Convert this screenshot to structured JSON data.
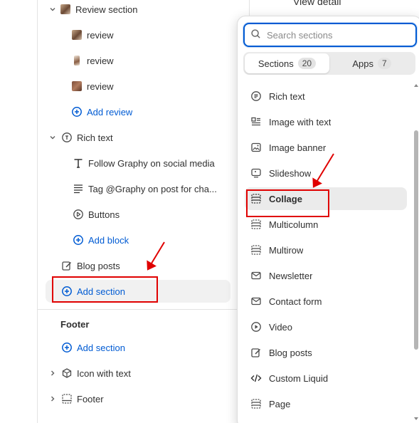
{
  "tree": {
    "review_section": "Review section",
    "reviews": [
      "review",
      "review",
      "review"
    ],
    "add_review": "Add review",
    "rich_text": "Rich text",
    "follow_graphy": "Follow Graphy on social media",
    "tag_graphy": "Tag @Graphy on post for cha...",
    "buttons": "Buttons",
    "add_block": "Add block",
    "blog_posts": "Blog posts",
    "add_section": "Add section"
  },
  "footer": {
    "title": "Footer",
    "add_section": "Add section",
    "icon_with_text": "Icon with text",
    "footer_item": "Footer"
  },
  "header": {
    "view_detail": "View detail"
  },
  "popup": {
    "search_placeholder": "Search sections",
    "tabs": [
      {
        "label": "Sections",
        "count": "20"
      },
      {
        "label": "Apps",
        "count": "7"
      }
    ],
    "items": [
      {
        "label": "Rich text",
        "icon": "text-block-icon"
      },
      {
        "label": "Image with text",
        "icon": "image-with-text-icon"
      },
      {
        "label": "Image banner",
        "icon": "image-icon"
      },
      {
        "label": "Slideshow",
        "icon": "slideshow-icon"
      },
      {
        "label": "Collage",
        "icon": "layout-icon"
      },
      {
        "label": "Multicolumn",
        "icon": "layout-icon"
      },
      {
        "label": "Multirow",
        "icon": "layout-icon"
      },
      {
        "label": "Newsletter",
        "icon": "mail-icon"
      },
      {
        "label": "Contact form",
        "icon": "mail-icon"
      },
      {
        "label": "Video",
        "icon": "play-icon"
      },
      {
        "label": "Blog posts",
        "icon": "edit-icon"
      },
      {
        "label": "Custom Liquid",
        "icon": "code-icon"
      },
      {
        "label": "Page",
        "icon": "layout-icon"
      }
    ]
  },
  "colors": {
    "accent": "#005bd3",
    "annotation": "#e00000",
    "selected_bg": "#ebebeb"
  }
}
